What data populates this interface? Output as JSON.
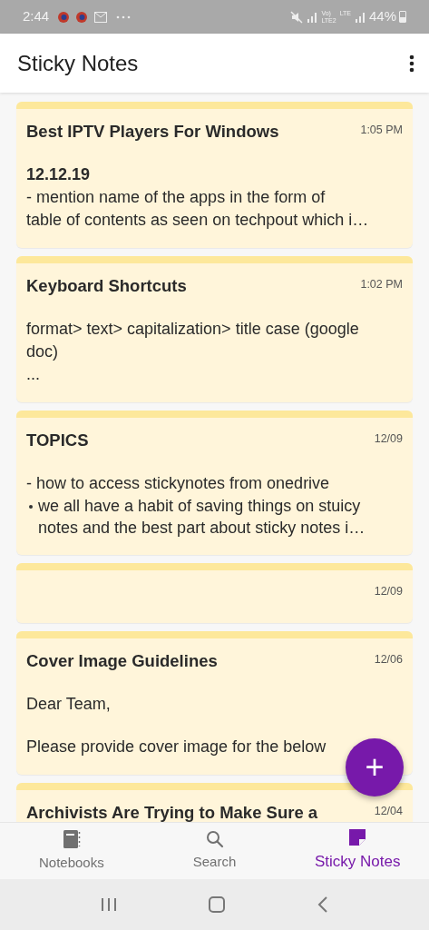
{
  "status_bar": {
    "time": "2:44",
    "volte": "Vo)",
    "volte_line": "LTE2",
    "network": "LTE",
    "battery": "44%"
  },
  "app_bar": {
    "title": "Sticky Notes"
  },
  "notes": [
    {
      "title": "Best IPTV Players For Windows",
      "time": "1:05 PM",
      "paragraphs": [
        [
          {
            "kind": "bold",
            "text": "12.12.19"
          },
          {
            "kind": "text",
            "text": "- mention name of the apps in the form of"
          },
          {
            "kind": "text",
            "text": "table of contents as seen on techpout which i…"
          }
        ]
      ]
    },
    {
      "title": "Keyboard Shortcuts",
      "time": "1:02 PM",
      "paragraphs": [
        [
          {
            "kind": "text",
            "text": "format> text> capitalization> title case (google"
          },
          {
            "kind": "text",
            "text": "doc)"
          },
          {
            "kind": "text",
            "text": "..."
          }
        ]
      ]
    },
    {
      "title": "TOPICS",
      "time": "12/09",
      "paragraphs": [
        [
          {
            "kind": "text",
            "text": "- how to access stickynotes from onedrive"
          },
          {
            "kind": "bullet",
            "text": "we all have a habit of saving things on stuicy"
          },
          {
            "kind": "continuation",
            "text": "notes and the best part about sticky notes i…"
          }
        ]
      ]
    },
    {
      "time": "12/09"
    },
    {
      "title": "Cover Image Guidelines",
      "time": "12/06",
      "paragraphs": [
        [
          {
            "kind": "text",
            "text": "Dear Team,"
          }
        ],
        [
          {
            "kind": "text",
            "text": "Please provide cover image for the below"
          }
        ]
      ]
    },
    {
      "title": "Archivists Are Trying to Make Sure a",
      "time": "12/04"
    }
  ],
  "fab": {
    "label": "+"
  },
  "bottom_nav": [
    {
      "kind": "notebook",
      "label": "Notebooks",
      "selected": false
    },
    {
      "kind": "search",
      "label": "Search",
      "selected": false
    },
    {
      "kind": "sticky",
      "label": "Sticky Notes",
      "selected": true
    }
  ]
}
